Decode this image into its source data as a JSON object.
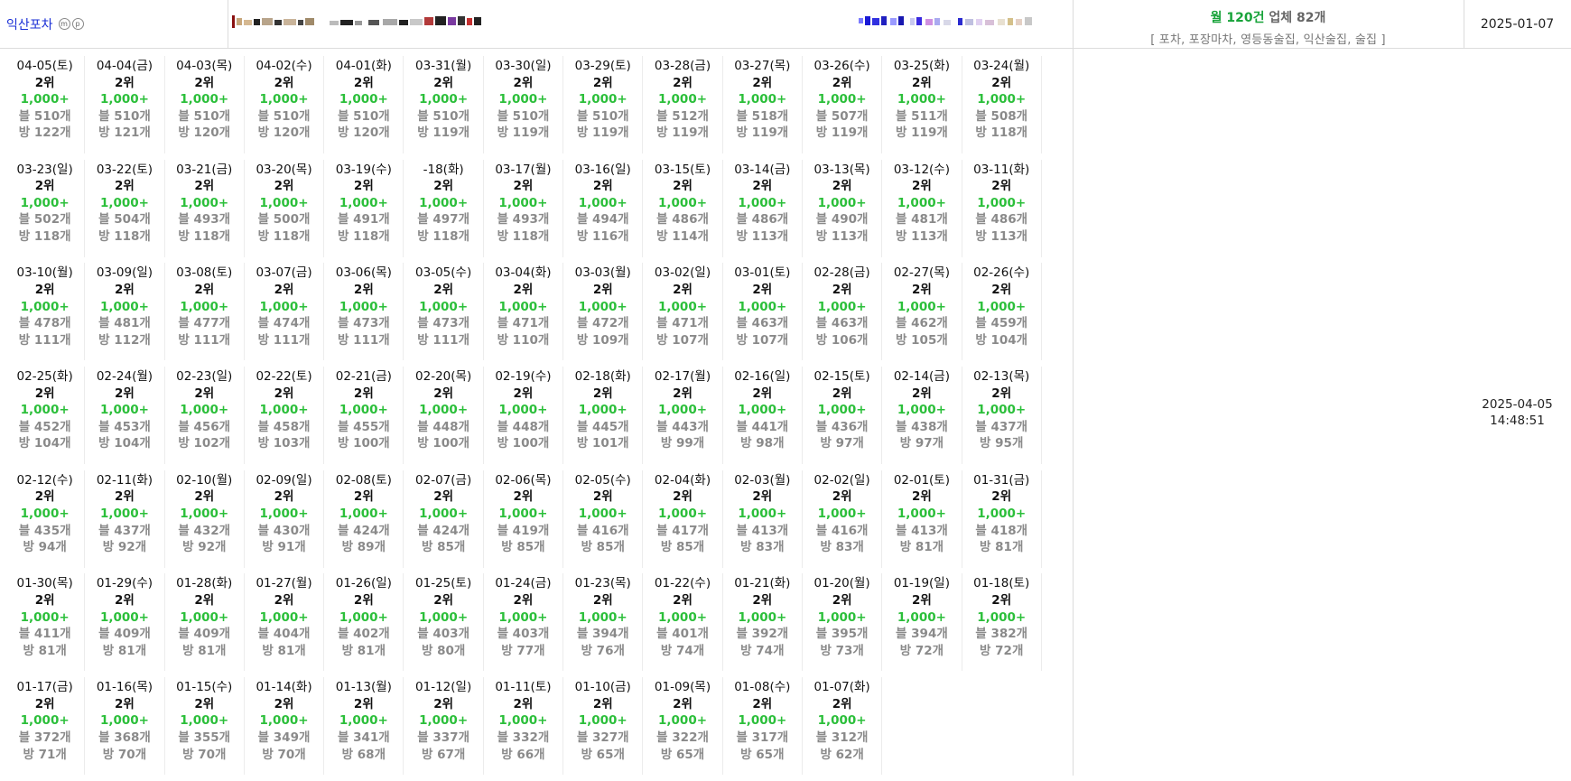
{
  "header": {
    "shop_name": "익산포차",
    "badges": [
      "m",
      "p"
    ],
    "summary": {
      "monthly": "월 120건",
      "total": "업체 82개",
      "categories": "[ 포차, 포장마차, 영등동술집, 익산술집, 술집 ]"
    },
    "start_date": "2025-01-07"
  },
  "side": {
    "updated_date": "2025-04-05",
    "updated_time": "14:48:51"
  },
  "colors": {
    "link": "#1a2fd6",
    "count_green": "#2bbf3a",
    "monthly_green": "#18a33a",
    "muted_gray": "#8a8a8a"
  },
  "days": [
    {
      "date": "04-05(토)",
      "rank": "2위",
      "count": "1,000+",
      "blog": "블 510개",
      "room": "방 122개"
    },
    {
      "date": "04-04(금)",
      "rank": "2위",
      "count": "1,000+",
      "blog": "블 510개",
      "room": "방 121개"
    },
    {
      "date": "04-03(목)",
      "rank": "2위",
      "count": "1,000+",
      "blog": "블 510개",
      "room": "방 120개"
    },
    {
      "date": "04-02(수)",
      "rank": "2위",
      "count": "1,000+",
      "blog": "블 510개",
      "room": "방 120개"
    },
    {
      "date": "04-01(화)",
      "rank": "2위",
      "count": "1,000+",
      "blog": "블 510개",
      "room": "방 120개"
    },
    {
      "date": "03-31(월)",
      "rank": "2위",
      "count": "1,000+",
      "blog": "블 510개",
      "room": "방 119개"
    },
    {
      "date": "03-30(일)",
      "rank": "2위",
      "count": "1,000+",
      "blog": "블 510개",
      "room": "방 119개"
    },
    {
      "date": "03-29(토)",
      "rank": "2위",
      "count": "1,000+",
      "blog": "블 510개",
      "room": "방 119개"
    },
    {
      "date": "03-28(금)",
      "rank": "2위",
      "count": "1,000+",
      "blog": "블 512개",
      "room": "방 119개"
    },
    {
      "date": "03-27(목)",
      "rank": "2위",
      "count": "1,000+",
      "blog": "블 518개",
      "room": "방 119개"
    },
    {
      "date": "03-26(수)",
      "rank": "2위",
      "count": "1,000+",
      "blog": "블 507개",
      "room": "방 119개"
    },
    {
      "date": "03-25(화)",
      "rank": "2위",
      "count": "1,000+",
      "blog": "블 511개",
      "room": "방 119개"
    },
    {
      "date": "03-24(월)",
      "rank": "2위",
      "count": "1,000+",
      "blog": "블 508개",
      "room": "방 118개"
    },
    {
      "date": "03-23(일)",
      "rank": "2위",
      "count": "1,000+",
      "blog": "블 502개",
      "room": "방 118개"
    },
    {
      "date": "03-22(토)",
      "rank": "2위",
      "count": "1,000+",
      "blog": "블 504개",
      "room": "방 118개"
    },
    {
      "date": "03-21(금)",
      "rank": "2위",
      "count": "1,000+",
      "blog": "블 493개",
      "room": "방 118개"
    },
    {
      "date": "03-20(목)",
      "rank": "2위",
      "count": "1,000+",
      "blog": "블 500개",
      "room": "방 118개"
    },
    {
      "date": "03-19(수)",
      "rank": "2위",
      "count": "1,000+",
      "blog": "블 491개",
      "room": "방 118개"
    },
    {
      "date": "-18(화)",
      "rank": "2위",
      "count": "1,000+",
      "blog": "블 497개",
      "room": "방 118개"
    },
    {
      "date": "03-17(월)",
      "rank": "2위",
      "count": "1,000+",
      "blog": "블 493개",
      "room": "방 118개"
    },
    {
      "date": "03-16(일)",
      "rank": "2위",
      "count": "1,000+",
      "blog": "블 494개",
      "room": "방 116개"
    },
    {
      "date": "03-15(토)",
      "rank": "2위",
      "count": "1,000+",
      "blog": "블 486개",
      "room": "방 114개"
    },
    {
      "date": "03-14(금)",
      "rank": "2위",
      "count": "1,000+",
      "blog": "블 486개",
      "room": "방 113개"
    },
    {
      "date": "03-13(목)",
      "rank": "2위",
      "count": "1,000+",
      "blog": "블 490개",
      "room": "방 113개"
    },
    {
      "date": "03-12(수)",
      "rank": "2위",
      "count": "1,000+",
      "blog": "블 481개",
      "room": "방 113개"
    },
    {
      "date": "03-11(화)",
      "rank": "2위",
      "count": "1,000+",
      "blog": "블 486개",
      "room": "방 113개"
    },
    {
      "date": "03-10(월)",
      "rank": "2위",
      "count": "1,000+",
      "blog": "블 478개",
      "room": "방 111개"
    },
    {
      "date": "03-09(일)",
      "rank": "2위",
      "count": "1,000+",
      "blog": "블 481개",
      "room": "방 112개"
    },
    {
      "date": "03-08(토)",
      "rank": "2위",
      "count": "1,000+",
      "blog": "블 477개",
      "room": "방 111개"
    },
    {
      "date": "03-07(금)",
      "rank": "2위",
      "count": "1,000+",
      "blog": "블 474개",
      "room": "방 111개"
    },
    {
      "date": "03-06(목)",
      "rank": "2위",
      "count": "1,000+",
      "blog": "블 473개",
      "room": "방 111개"
    },
    {
      "date": "03-05(수)",
      "rank": "2위",
      "count": "1,000+",
      "blog": "블 473개",
      "room": "방 111개"
    },
    {
      "date": "03-04(화)",
      "rank": "2위",
      "count": "1,000+",
      "blog": "블 471개",
      "room": "방 110개"
    },
    {
      "date": "03-03(월)",
      "rank": "2위",
      "count": "1,000+",
      "blog": "블 472개",
      "room": "방 109개"
    },
    {
      "date": "03-02(일)",
      "rank": "2위",
      "count": "1,000+",
      "blog": "블 471개",
      "room": "방 107개"
    },
    {
      "date": "03-01(토)",
      "rank": "2위",
      "count": "1,000+",
      "blog": "블 463개",
      "room": "방 107개"
    },
    {
      "date": "02-28(금)",
      "rank": "2위",
      "count": "1,000+",
      "blog": "블 463개",
      "room": "방 106개"
    },
    {
      "date": "02-27(목)",
      "rank": "2위",
      "count": "1,000+",
      "blog": "블 462개",
      "room": "방 105개"
    },
    {
      "date": "02-26(수)",
      "rank": "2위",
      "count": "1,000+",
      "blog": "블 459개",
      "room": "방 104개"
    },
    {
      "date": "02-25(화)",
      "rank": "2위",
      "count": "1,000+",
      "blog": "블 452개",
      "room": "방 104개"
    },
    {
      "date": "02-24(월)",
      "rank": "2위",
      "count": "1,000+",
      "blog": "블 453개",
      "room": "방 104개"
    },
    {
      "date": "02-23(일)",
      "rank": "2위",
      "count": "1,000+",
      "blog": "블 456개",
      "room": "방 102개"
    },
    {
      "date": "02-22(토)",
      "rank": "2위",
      "count": "1,000+",
      "blog": "블 458개",
      "room": "방 103개"
    },
    {
      "date": "02-21(금)",
      "rank": "2위",
      "count": "1,000+",
      "blog": "블 455개",
      "room": "방 100개"
    },
    {
      "date": "02-20(목)",
      "rank": "2위",
      "count": "1,000+",
      "blog": "블 448개",
      "room": "방 100개"
    },
    {
      "date": "02-19(수)",
      "rank": "2위",
      "count": "1,000+",
      "blog": "블 448개",
      "room": "방 100개"
    },
    {
      "date": "02-18(화)",
      "rank": "2위",
      "count": "1,000+",
      "blog": "블 445개",
      "room": "방 101개"
    },
    {
      "date": "02-17(월)",
      "rank": "2위",
      "count": "1,000+",
      "blog": "블 443개",
      "room": "방 99개"
    },
    {
      "date": "02-16(일)",
      "rank": "2위",
      "count": "1,000+",
      "blog": "블 441개",
      "room": "방 98개"
    },
    {
      "date": "02-15(토)",
      "rank": "2위",
      "count": "1,000+",
      "blog": "블 436개",
      "room": "방 97개"
    },
    {
      "date": "02-14(금)",
      "rank": "2위",
      "count": "1,000+",
      "blog": "블 438개",
      "room": "방 97개"
    },
    {
      "date": "02-13(목)",
      "rank": "2위",
      "count": "1,000+",
      "blog": "블 437개",
      "room": "방 95개"
    },
    {
      "date": "02-12(수)",
      "rank": "2위",
      "count": "1,000+",
      "blog": "블 435개",
      "room": "방 94개"
    },
    {
      "date": "02-11(화)",
      "rank": "2위",
      "count": "1,000+",
      "blog": "블 437개",
      "room": "방 92개"
    },
    {
      "date": "02-10(월)",
      "rank": "2위",
      "count": "1,000+",
      "blog": "블 432개",
      "room": "방 92개"
    },
    {
      "date": "02-09(일)",
      "rank": "2위",
      "count": "1,000+",
      "blog": "블 430개",
      "room": "방 91개"
    },
    {
      "date": "02-08(토)",
      "rank": "2위",
      "count": "1,000+",
      "blog": "블 424개",
      "room": "방 89개"
    },
    {
      "date": "02-07(금)",
      "rank": "2위",
      "count": "1,000+",
      "blog": "블 424개",
      "room": "방 85개"
    },
    {
      "date": "02-06(목)",
      "rank": "2위",
      "count": "1,000+",
      "blog": "블 419개",
      "room": "방 85개"
    },
    {
      "date": "02-05(수)",
      "rank": "2위",
      "count": "1,000+",
      "blog": "블 416개",
      "room": "방 85개"
    },
    {
      "date": "02-04(화)",
      "rank": "2위",
      "count": "1,000+",
      "blog": "블 417개",
      "room": "방 85개"
    },
    {
      "date": "02-03(월)",
      "rank": "2위",
      "count": "1,000+",
      "blog": "블 413개",
      "room": "방 83개"
    },
    {
      "date": "02-02(일)",
      "rank": "2위",
      "count": "1,000+",
      "blog": "블 416개",
      "room": "방 83개"
    },
    {
      "date": "02-01(토)",
      "rank": "2위",
      "count": "1,000+",
      "blog": "블 413개",
      "room": "방 81개"
    },
    {
      "date": "01-31(금)",
      "rank": "2위",
      "count": "1,000+",
      "blog": "블 418개",
      "room": "방 81개"
    },
    {
      "date": "01-30(목)",
      "rank": "2위",
      "count": "1,000+",
      "blog": "블 411개",
      "room": "방 81개"
    },
    {
      "date": "01-29(수)",
      "rank": "2위",
      "count": "1,000+",
      "blog": "블 409개",
      "room": "방 81개"
    },
    {
      "date": "01-28(화)",
      "rank": "2위",
      "count": "1,000+",
      "blog": "블 409개",
      "room": "방 81개"
    },
    {
      "date": "01-27(월)",
      "rank": "2위",
      "count": "1,000+",
      "blog": "블 404개",
      "room": "방 81개"
    },
    {
      "date": "01-26(일)",
      "rank": "2위",
      "count": "1,000+",
      "blog": "블 402개",
      "room": "방 81개"
    },
    {
      "date": "01-25(토)",
      "rank": "2위",
      "count": "1,000+",
      "blog": "블 403개",
      "room": "방 80개"
    },
    {
      "date": "01-24(금)",
      "rank": "2위",
      "count": "1,000+",
      "blog": "블 403개",
      "room": "방 77개"
    },
    {
      "date": "01-23(목)",
      "rank": "2위",
      "count": "1,000+",
      "blog": "블 394개",
      "room": "방 76개"
    },
    {
      "date": "01-22(수)",
      "rank": "2위",
      "count": "1,000+",
      "blog": "블 401개",
      "room": "방 74개"
    },
    {
      "date": "01-21(화)",
      "rank": "2위",
      "count": "1,000+",
      "blog": "블 392개",
      "room": "방 74개"
    },
    {
      "date": "01-20(월)",
      "rank": "2위",
      "count": "1,000+",
      "blog": "블 395개",
      "room": "방 73개"
    },
    {
      "date": "01-19(일)",
      "rank": "2위",
      "count": "1,000+",
      "blog": "블 394개",
      "room": "방 72개"
    },
    {
      "date": "01-18(토)",
      "rank": "2위",
      "count": "1,000+",
      "blog": "블 382개",
      "room": "방 72개"
    },
    {
      "date": "01-17(금)",
      "rank": "2위",
      "count": "1,000+",
      "blog": "블 372개",
      "room": "방 71개"
    },
    {
      "date": "01-16(목)",
      "rank": "2위",
      "count": "1,000+",
      "blog": "블 368개",
      "room": "방 70개"
    },
    {
      "date": "01-15(수)",
      "rank": "2위",
      "count": "1,000+",
      "blog": "블 355개",
      "room": "방 70개"
    },
    {
      "date": "01-14(화)",
      "rank": "2위",
      "count": "1,000+",
      "blog": "블 349개",
      "room": "방 70개"
    },
    {
      "date": "01-13(월)",
      "rank": "2위",
      "count": "1,000+",
      "blog": "블 341개",
      "room": "방 68개"
    },
    {
      "date": "01-12(일)",
      "rank": "2위",
      "count": "1,000+",
      "blog": "블 337개",
      "room": "방 67개"
    },
    {
      "date": "01-11(토)",
      "rank": "2위",
      "count": "1,000+",
      "blog": "블 332개",
      "room": "방 66개"
    },
    {
      "date": "01-10(금)",
      "rank": "2위",
      "count": "1,000+",
      "blog": "블 327개",
      "room": "방 65개"
    },
    {
      "date": "01-09(목)",
      "rank": "2위",
      "count": "1,000+",
      "blog": "블 322개",
      "room": "방 65개"
    },
    {
      "date": "01-08(수)",
      "rank": "2위",
      "count": "1,000+",
      "blog": "블 317개",
      "room": "방 65개"
    },
    {
      "date": "01-07(화)",
      "rank": "2위",
      "count": "1,000+",
      "blog": "블 312개",
      "room": "방 62개"
    }
  ]
}
